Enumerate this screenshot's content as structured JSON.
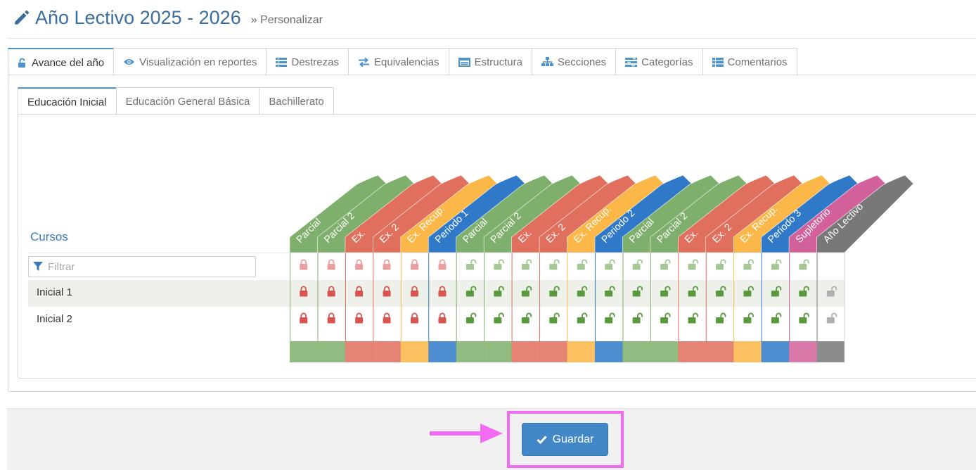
{
  "page": {
    "title": "Año Lectivo 2025 - 2026",
    "breadcrumb": "» Personalizar"
  },
  "main_tabs": [
    {
      "label": "Avance del año",
      "icon": "unlock-icon",
      "active": true
    },
    {
      "label": "Visualización en reportes",
      "icon": "eye-icon",
      "active": false
    },
    {
      "label": "Destrezas",
      "icon": "list-icon",
      "active": false
    },
    {
      "label": "Equivalencias",
      "icon": "exchange-icon",
      "active": false
    },
    {
      "label": "Estructura",
      "icon": "window-icon",
      "active": false
    },
    {
      "label": "Secciones",
      "icon": "sitemap-icon",
      "active": false
    },
    {
      "label": "Categorías",
      "icon": "tasks-icon",
      "active": false
    },
    {
      "label": "Comentarios",
      "icon": "table-list-icon",
      "active": false
    }
  ],
  "level_tabs": [
    {
      "label": "Educación Inicial",
      "active": true
    },
    {
      "label": "Educación General Básica",
      "active": false
    },
    {
      "label": "Bachillerato",
      "active": false
    }
  ],
  "courses": {
    "header": "Cursos",
    "filter_placeholder": "Filtrar",
    "filter_icon": "filter-icon",
    "rows": [
      "Inicial 1",
      "Inicial 2"
    ]
  },
  "colors": {
    "green": "#7faf6c",
    "red": "#e06f5e",
    "yellow": "#fbb747",
    "blue": "#2f79c8",
    "pink": "#d2619b",
    "gray": "#787878",
    "lock_red": "#d9534f",
    "lock_green": "#5a9a3f",
    "lock_gray": "#b0b0b0"
  },
  "columns": [
    {
      "label": "Parcial",
      "color": "green",
      "header_lock": "locked-light",
      "row_locks": [
        "locked",
        "locked"
      ]
    },
    {
      "label": "Parcial 2",
      "color": "green",
      "header_lock": "locked-light",
      "row_locks": [
        "locked",
        "locked"
      ]
    },
    {
      "label": "Ex.",
      "color": "red",
      "header_lock": "locked-light",
      "row_locks": [
        "locked",
        "locked"
      ]
    },
    {
      "label": "Ex. 2",
      "color": "red",
      "header_lock": "locked-light",
      "row_locks": [
        "locked",
        "locked"
      ]
    },
    {
      "label": "Ex. Recup.",
      "color": "yellow",
      "header_lock": "locked-light",
      "row_locks": [
        "locked",
        "locked"
      ]
    },
    {
      "label": "Periodo 1",
      "color": "blue",
      "header_lock": "locked-light",
      "row_locks": [
        "locked",
        "locked"
      ]
    },
    {
      "label": "Parcial",
      "color": "green",
      "header_lock": "unlocked-light",
      "row_locks": [
        "unlocked",
        "unlocked"
      ]
    },
    {
      "label": "Parcial 2",
      "color": "green",
      "header_lock": "unlocked-light",
      "row_locks": [
        "unlocked",
        "unlocked"
      ]
    },
    {
      "label": "Ex.",
      "color": "red",
      "header_lock": "unlocked-light",
      "row_locks": [
        "unlocked",
        "unlocked"
      ]
    },
    {
      "label": "Ex. 2",
      "color": "red",
      "header_lock": "unlocked-light",
      "row_locks": [
        "unlocked",
        "unlocked"
      ]
    },
    {
      "label": "Ex. Recup.",
      "color": "yellow",
      "header_lock": "unlocked-light",
      "row_locks": [
        "unlocked",
        "unlocked"
      ]
    },
    {
      "label": "Periodo 2",
      "color": "blue",
      "header_lock": "unlocked-light",
      "row_locks": [
        "unlocked",
        "unlocked"
      ]
    },
    {
      "label": "Parcial",
      "color": "green",
      "header_lock": "unlocked-light",
      "row_locks": [
        "unlocked",
        "unlocked"
      ]
    },
    {
      "label": "Parcial 2",
      "color": "green",
      "header_lock": "unlocked-light",
      "row_locks": [
        "unlocked",
        "unlocked"
      ]
    },
    {
      "label": "Ex.",
      "color": "red",
      "header_lock": "unlocked-light",
      "row_locks": [
        "unlocked",
        "unlocked"
      ]
    },
    {
      "label": "Ex. 2",
      "color": "red",
      "header_lock": "unlocked-light",
      "row_locks": [
        "unlocked",
        "unlocked"
      ]
    },
    {
      "label": "Ex. Recup.",
      "color": "yellow",
      "header_lock": "unlocked-light",
      "row_locks": [
        "unlocked",
        "unlocked"
      ]
    },
    {
      "label": "Periodo 3",
      "color": "blue",
      "header_lock": "unlocked-light",
      "row_locks": [
        "unlocked",
        "unlocked"
      ]
    },
    {
      "label": "Supletorio",
      "color": "pink",
      "header_lock": "unlocked-light",
      "row_locks": [
        "unlocked",
        "unlocked"
      ]
    },
    {
      "label": "Año Lectivo",
      "color": "gray",
      "header_lock": "none",
      "row_locks": [
        "unlocked-gray",
        "unlocked-gray"
      ]
    }
  ],
  "footer": {
    "save_label": "Guardar",
    "save_icon": "check-icon"
  }
}
